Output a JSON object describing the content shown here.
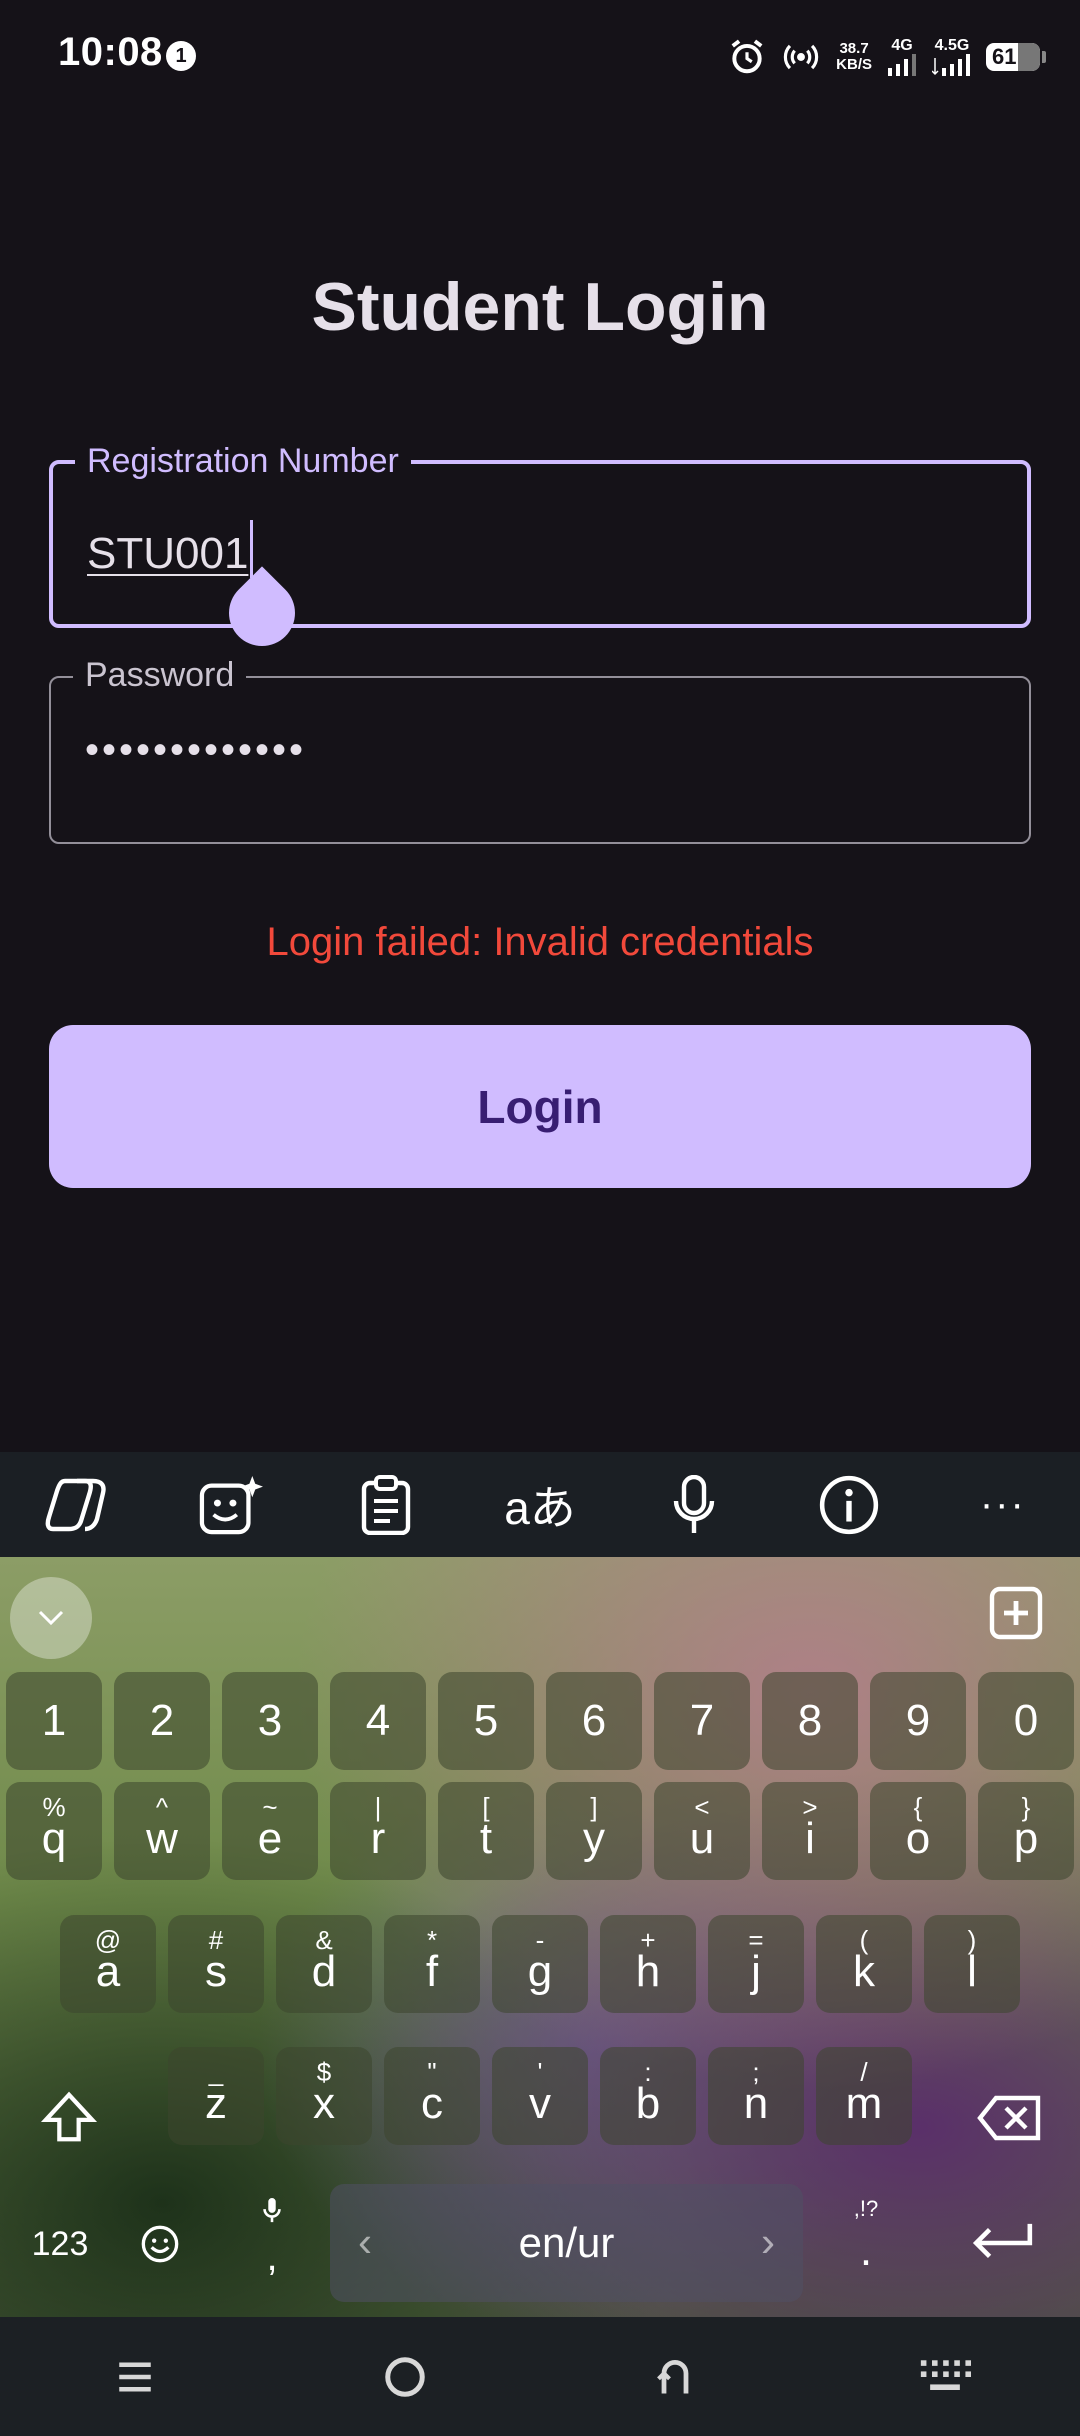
{
  "status_bar": {
    "time": "10:08",
    "notification_count": "1",
    "speed_value": "38.7",
    "speed_unit": "KB/S",
    "net1": "4G",
    "net2": "4.5G",
    "battery": "61"
  },
  "login": {
    "title": "Student Login",
    "registration_label": "Registration Number",
    "registration_value": "STU001",
    "password_label": "Password",
    "password_value": "•••••••••••••",
    "error": "Login failed: Invalid credentials",
    "button": "Login"
  },
  "keyboard": {
    "toolbar_icons": [
      "copilot-icon",
      "emoji-sticker-icon",
      "clipboard-icon",
      "translate-icon",
      "microphone-icon",
      "info-icon",
      "more-icon"
    ],
    "translate_glyph": "aあ",
    "more_glyph": "···",
    "number_row": [
      "1",
      "2",
      "3",
      "4",
      "5",
      "6",
      "7",
      "8",
      "9",
      "0"
    ],
    "row1": [
      {
        "main": "q",
        "sub": "%"
      },
      {
        "main": "w",
        "sub": "^"
      },
      {
        "main": "e",
        "sub": "~"
      },
      {
        "main": "r",
        "sub": "|"
      },
      {
        "main": "t",
        "sub": "["
      },
      {
        "main": "y",
        "sub": "]"
      },
      {
        "main": "u",
        "sub": "<"
      },
      {
        "main": "i",
        "sub": ">"
      },
      {
        "main": "o",
        "sub": "{"
      },
      {
        "main": "p",
        "sub": "}"
      }
    ],
    "row2": [
      {
        "main": "a",
        "sub": "@"
      },
      {
        "main": "s",
        "sub": "#"
      },
      {
        "main": "d",
        "sub": "&"
      },
      {
        "main": "f",
        "sub": "*"
      },
      {
        "main": "g",
        "sub": "-"
      },
      {
        "main": "h",
        "sub": "+"
      },
      {
        "main": "j",
        "sub": "="
      },
      {
        "main": "k",
        "sub": "("
      },
      {
        "main": "l",
        "sub": ")"
      }
    ],
    "row3": [
      {
        "main": "z",
        "sub": "_"
      },
      {
        "main": "x",
        "sub": "$"
      },
      {
        "main": "c",
        "sub": "\""
      },
      {
        "main": "v",
        "sub": "'"
      },
      {
        "main": "b",
        "sub": ":"
      },
      {
        "main": "n",
        "sub": ";"
      },
      {
        "main": "m",
        "sub": "/"
      }
    ],
    "numbers_toggle": "123",
    "comma": ",",
    "space_label": "en/ur",
    "period_main": ".",
    "period_sub": ",!?"
  },
  "nav_icons": [
    "menu-icon",
    "home-icon",
    "back-icon",
    "keyboard-switch-icon"
  ]
}
